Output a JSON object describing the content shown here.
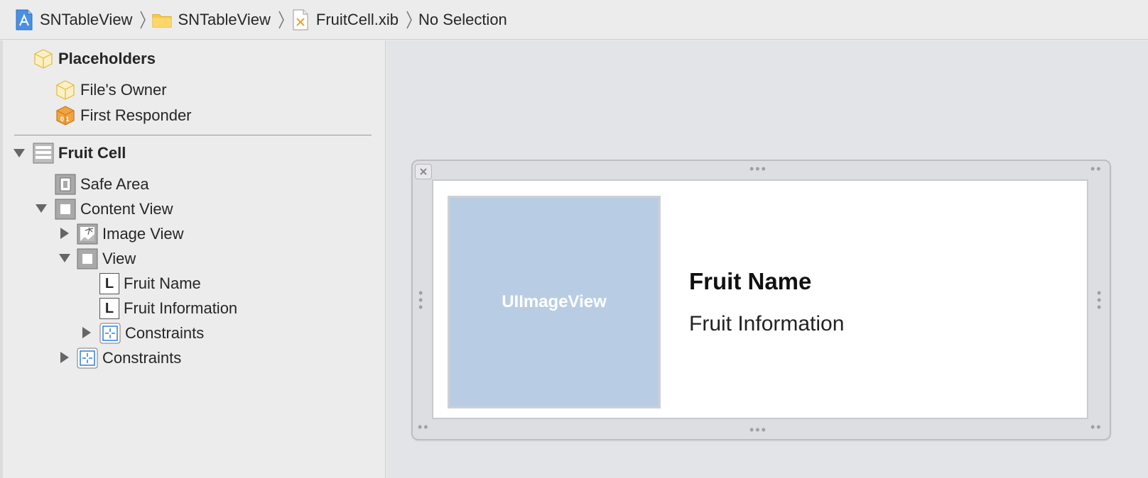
{
  "breadcrumb": {
    "items": [
      {
        "label": "SNTableView",
        "icon": "xcode-project-icon"
      },
      {
        "label": "SNTableView",
        "icon": "folder-icon"
      },
      {
        "label": "FruitCell.xib",
        "icon": "xib-file-icon"
      },
      {
        "label": "No Selection",
        "icon": ""
      }
    ]
  },
  "outline": {
    "placeholders": {
      "title": "Placeholders",
      "items": [
        {
          "label": "File's Owner",
          "icon": "placeholder-cube-icon"
        },
        {
          "label": "First Responder",
          "icon": "first-responder-icon"
        }
      ]
    },
    "tree": {
      "fruit_cell": "Fruit Cell",
      "safe_area": "Safe Area",
      "content_view": "Content View",
      "image_view": "Image View",
      "view": "View",
      "fruit_name": "Fruit Name",
      "fruit_information": "Fruit Information",
      "constraints_inner": "Constraints",
      "constraints_outer": "Constraints",
      "label_badge": "L"
    }
  },
  "canvas": {
    "image_view_label": "UIImageView",
    "fruit_name": "Fruit Name",
    "fruit_information": "Fruit Information",
    "image_placeholder_color": "#b8cce4"
  }
}
